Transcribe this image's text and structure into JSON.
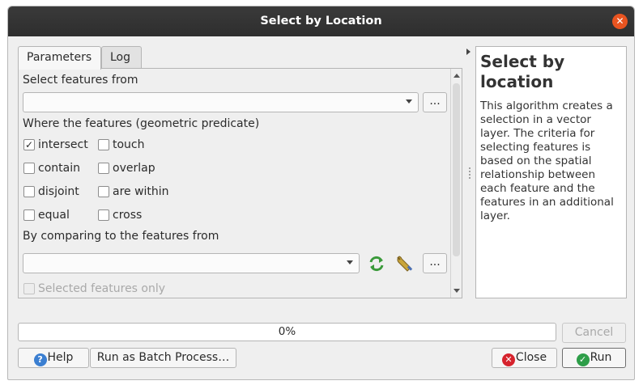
{
  "window": {
    "title": "Select by Location"
  },
  "tabs": [
    {
      "label": "Parameters",
      "active": true
    },
    {
      "label": "Log",
      "active": false
    }
  ],
  "params": {
    "select_from_label": "Select features from",
    "select_from_value": "",
    "browse_label": "...",
    "predicate_label": "Where the features (geometric predicate)",
    "predicates": [
      {
        "label": "intersect",
        "checked": true
      },
      {
        "label": "touch",
        "checked": false
      },
      {
        "label": "contain",
        "checked": false
      },
      {
        "label": "overlap",
        "checked": false
      },
      {
        "label": "disjoint",
        "checked": false
      },
      {
        "label": "are within",
        "checked": false
      },
      {
        "label": "equal",
        "checked": false
      },
      {
        "label": "cross",
        "checked": false
      }
    ],
    "compare_label": "By comparing to the features from",
    "compare_value": "",
    "compare_browse_label": "...",
    "selected_only_label": "Selected features only",
    "check_mark": "✓"
  },
  "help": {
    "title": "Select by location",
    "body": "This algorithm creates a selection in a vector layer. The criteria for selecting features is based on the spatial relationship between each feature and the features in an additional layer."
  },
  "progress": {
    "text": "0%",
    "value": 0
  },
  "buttons": {
    "cancel": "Cancel",
    "help": "Help",
    "batch": "Run as Batch Process…",
    "close": "Close",
    "run": "Run"
  },
  "icons": {
    "help": "help-icon",
    "close": "close-icon",
    "run": "run-icon",
    "iterate": "iterate-icon",
    "wrench": "wrench-icon"
  },
  "colors": {
    "titlebar": "#2e2e2e",
    "close_button": "#e95420",
    "help_icon": "#3b7fd1",
    "close_icon": "#d6232d",
    "run_icon": "#2e9e49"
  }
}
